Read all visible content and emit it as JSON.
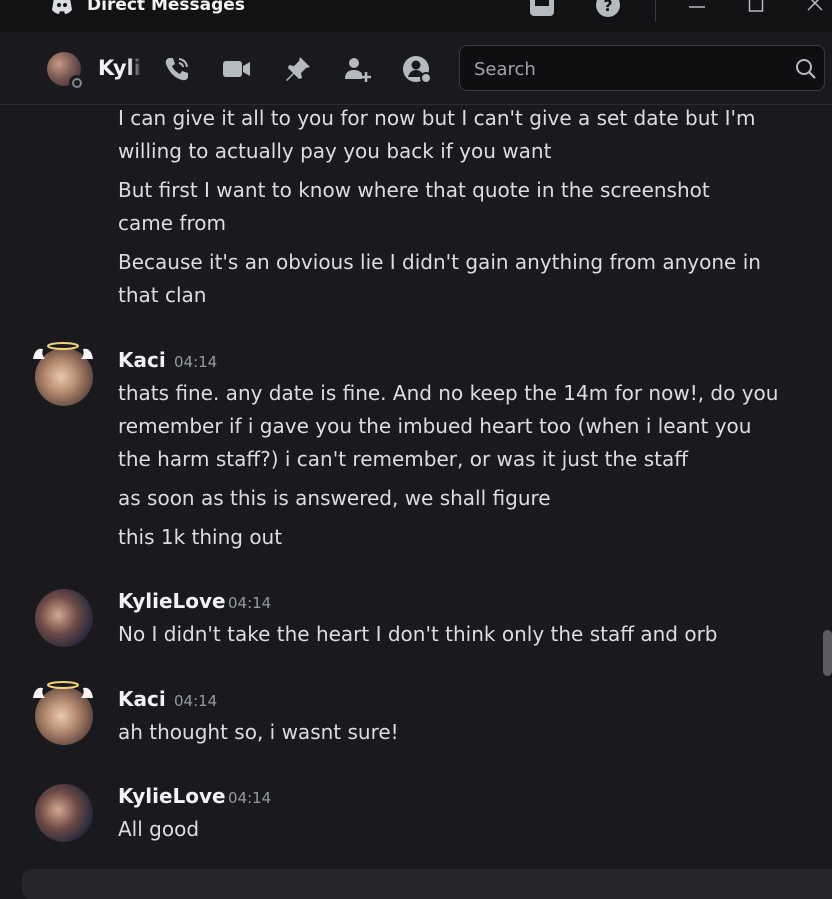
{
  "titlebar": {
    "title": "Direct Messages",
    "icons": [
      "discord-logo-icon",
      "inbox-icon",
      "help-icon",
      "minimize-icon",
      "maximize-icon",
      "close-icon"
    ]
  },
  "header": {
    "recipient_name": "KylieLove",
    "status": "offline",
    "icons": [
      "phone-call-icon",
      "video-call-icon",
      "pin-icon",
      "add-friends-icon",
      "user-profile-icon"
    ],
    "search_placeholder": "Search"
  },
  "messages": [
    {
      "author": null,
      "continued_lines": [
        "I can give it all to you for now but I can't give a set date but I'm",
        "willing to actually pay you back if you want",
        "But first I want to know where that quote in the screenshot",
        "came from",
        "Because it's an obvious lie I didn't gain anything from anyone in",
        "that clan"
      ]
    },
    {
      "author": "Kaci",
      "time": "04:14",
      "lines": [
        "thats fine. any date is fine. And no keep the 14m for now!, do you",
        "remember if i gave you the imbued heart too (when i leant you",
        "the harm staff?) i can't remember, or was it just the staff",
        "as soon as this is answered, we shall figure",
        "this 1k thing out"
      ]
    },
    {
      "author": "KylieLove",
      "time": "04:14",
      "lines": [
        "No I didn't take the heart I don't think only the staff and orb"
      ]
    },
    {
      "author": "Kaci",
      "time": "04:14",
      "lines": [
        "ah thought so, i wasnt sure!"
      ]
    },
    {
      "author": "KylieLove",
      "time": "04:14",
      "lines": [
        "All good"
      ]
    }
  ],
  "colors": {
    "background": "#1a1a1e",
    "titlebar": "#121214",
    "text": "#dbdee1",
    "author": "#f2f3f5",
    "timestamp": "#949ba4"
  }
}
